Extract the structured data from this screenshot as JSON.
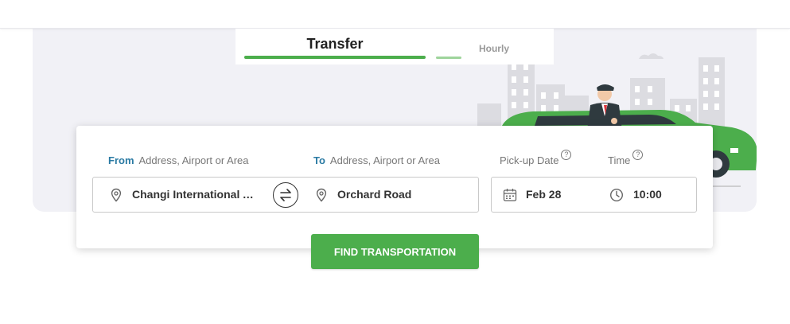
{
  "tabs": [
    {
      "label": "Transfer",
      "active": true
    },
    {
      "label": "Hourly",
      "active": false
    }
  ],
  "form": {
    "from_label": "From",
    "from_placeholder": "Address, Airport or Area",
    "from_value": "Changi International Airport",
    "to_label": "To",
    "to_placeholder": "Address, Airport or Area",
    "to_value": "Orchard Road",
    "date_label": "Pick-up Date",
    "time_label": "Time",
    "help_glyph": "?",
    "date_value": "Feb 28",
    "time_value": "10:00"
  },
  "button": {
    "label": "FIND TRANSPORTATION"
  },
  "icons": [
    "location-pin-icon",
    "swap-icon",
    "calendar-icon",
    "clock-icon",
    "help-icon"
  ],
  "colors": {
    "accent": "#4cae4c",
    "label_blue": "#2a7aa3",
    "hero_bg": "#f1f1f6"
  }
}
